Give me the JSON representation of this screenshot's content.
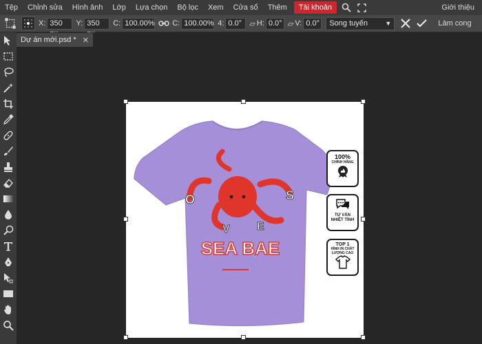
{
  "menu": {
    "items": [
      "Tệp",
      "Chỉnh sửa",
      "Hình ảnh",
      "Lớp",
      "Lựa chọn",
      "Bộ lọc",
      "Xem",
      "Cửa sổ",
      "Thêm",
      "Tài khoản"
    ],
    "active_index": 9,
    "right_label": "Giới thiệu",
    "icons": [
      "search-icon",
      "fullscreen-icon"
    ]
  },
  "options": {
    "x_label": "X:",
    "x_value": "350 px",
    "y_label": "Y:",
    "y_value": "350 px",
    "w_label": "C:",
    "w_value": "100.00%",
    "h_label": "C:",
    "h_value": "100.00%",
    "angle_label": "4:",
    "angle_value": "0.0°",
    "skew_h_label": "H:",
    "skew_h_value": "0.0°",
    "skew_v_label": "V:",
    "skew_v_value": "0.0°",
    "interpolation": "Song tuyến",
    "warp_label": "Làm cong"
  },
  "tab": {
    "title": "Dự án mới.psd *",
    "close": "✕"
  },
  "tools": [
    "move-tool-icon",
    "marquee-tool-icon",
    "lasso-tool-icon",
    "magic-wand-icon",
    "crop-tool-icon",
    "eyedropper-icon",
    "healing-brush-icon",
    "brush-tool-icon",
    "clone-stamp-icon",
    "eraser-icon",
    "gradient-tool-icon",
    "blur-tool-icon",
    "dodge-tool-icon",
    "type-tool-icon",
    "pen-tool-icon",
    "path-select-icon",
    "rectangle-tool-icon",
    "hand-tool-icon",
    "zoom-tool-icon"
  ],
  "artwork": {
    "shirt_color": "#a58fd8",
    "octopus_color": "#e0352b",
    "title_text": "SEA BAE",
    "badges": [
      {
        "line1": "100%",
        "line2": "CHÍNH HÃNG"
      },
      {
        "line1": "TƯ VẤN",
        "line2": "NHIỆT TÌNH"
      },
      {
        "line1": "TOP 1",
        "line2": "HÌNH IN CHẤT LƯỢNG CAO"
      }
    ]
  },
  "colors": {
    "accent": "#c8282e",
    "menubar": "#3a3a3a",
    "optionsbar": "#474747",
    "workspace": "#262626"
  }
}
